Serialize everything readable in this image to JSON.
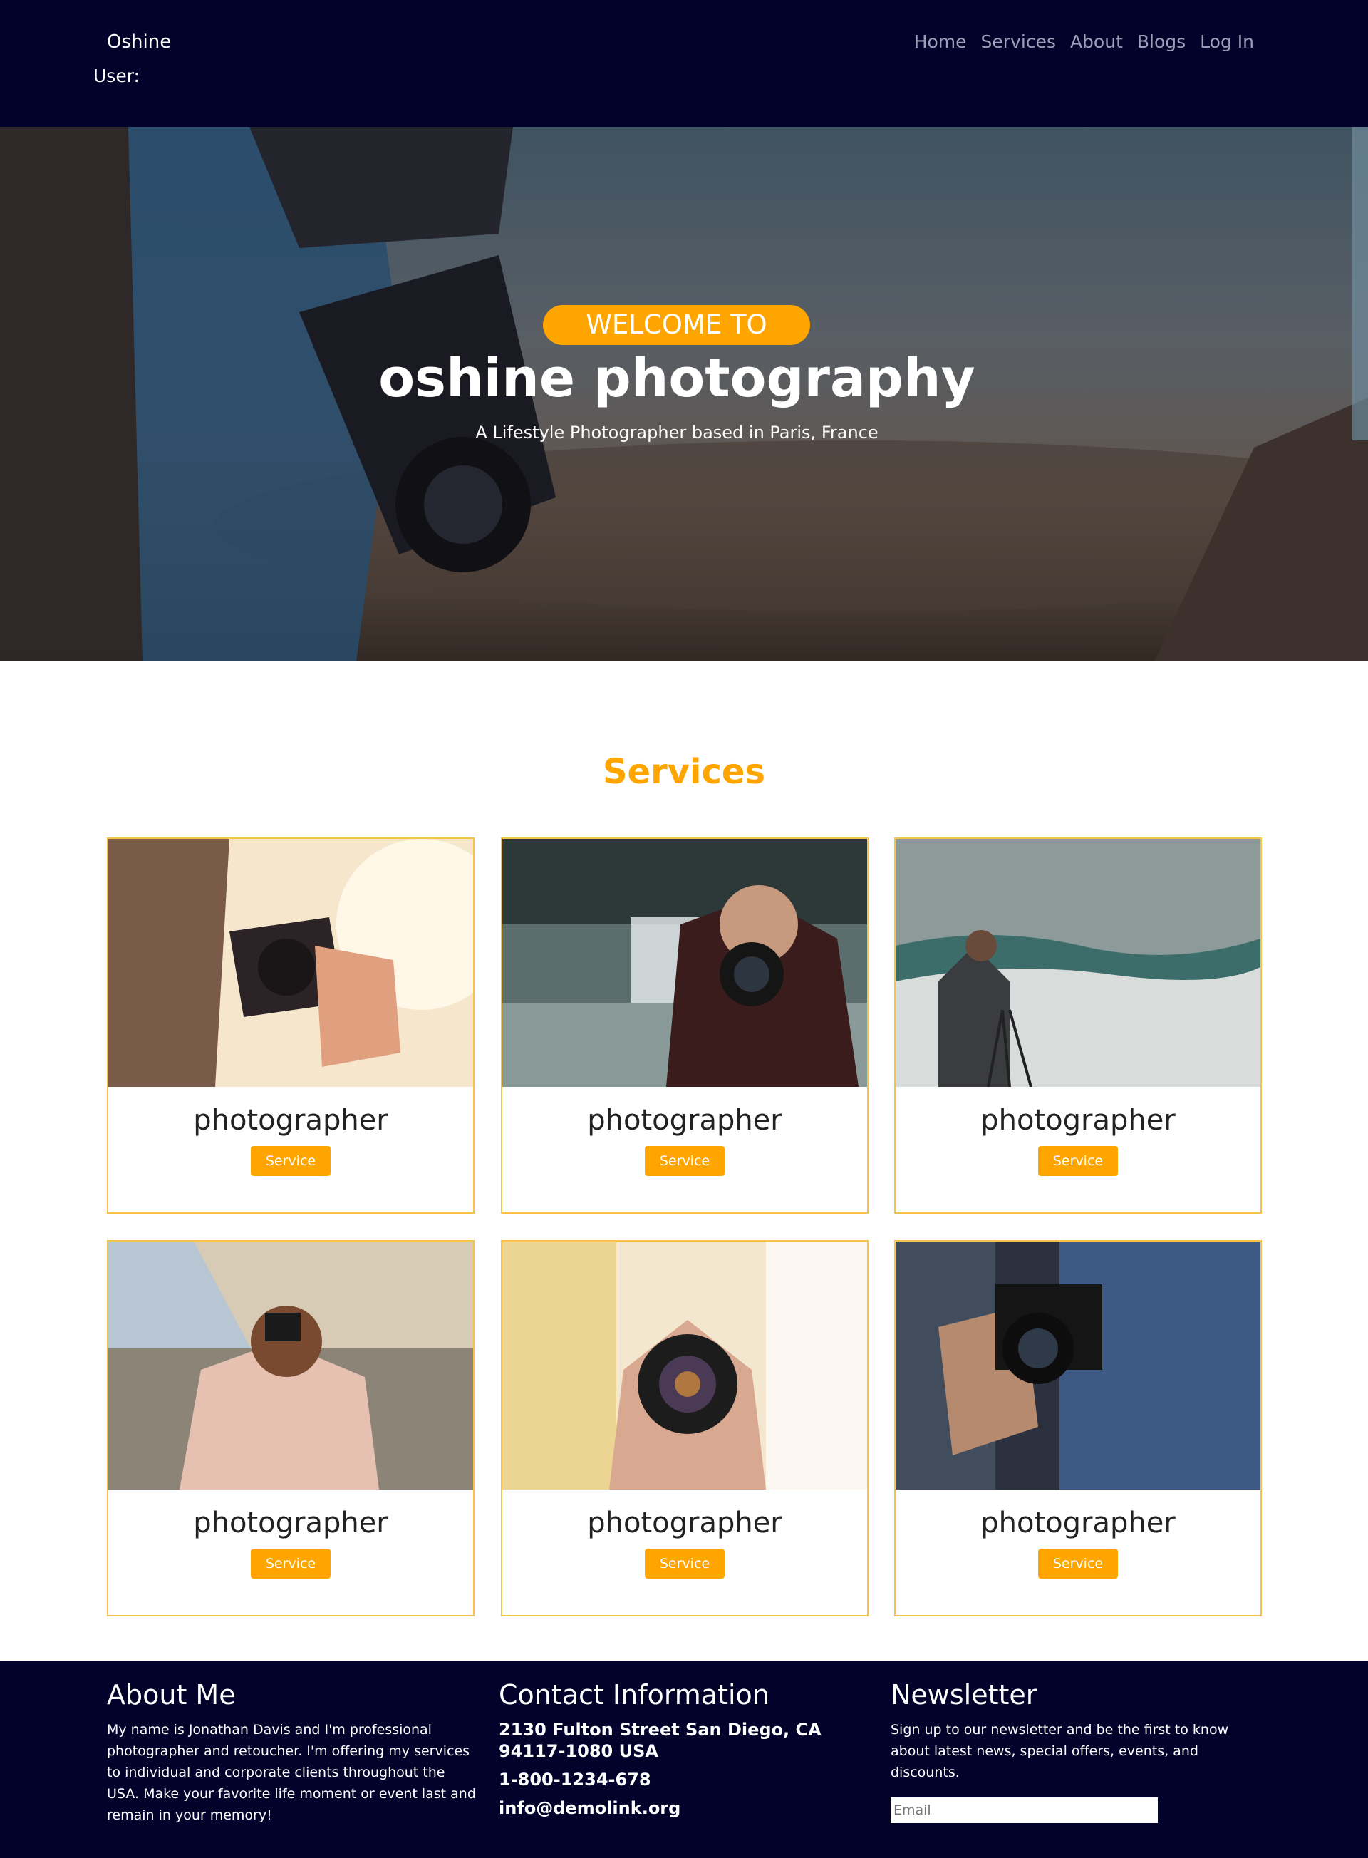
{
  "header": {
    "brand": "Oshine",
    "user_label": "User:",
    "nav": [
      "Home",
      "Services",
      "About",
      "Blogs",
      "Log In"
    ]
  },
  "hero": {
    "welcome": "WELCOME TO",
    "title": "oshine photography",
    "subtitle": "A Lifestyle Photographer based in Paris, France"
  },
  "services": {
    "title": "Services",
    "cards": [
      {
        "title": "photographer",
        "button": "Service"
      },
      {
        "title": "photographer",
        "button": "Service"
      },
      {
        "title": "photographer",
        "button": "Service"
      },
      {
        "title": "photographer",
        "button": "Service"
      },
      {
        "title": "photographer",
        "button": "Service"
      },
      {
        "title": "photographer",
        "button": "Service"
      }
    ]
  },
  "footer": {
    "about": {
      "title": "About Me",
      "text": "My name is Jonathan Davis and I'm professional photographer and retoucher. I'm offering my services to individual and corporate clients throughout the USA. Make your favorite life moment or event last and remain in your memory!"
    },
    "contact": {
      "title": "Contact Information",
      "address": "2130 Fulton Street San Diego, CA 94117-1080 USA",
      "phone": "1-800-1234-678",
      "email": "info@demolink.org"
    },
    "newsletter": {
      "title": "Newsletter",
      "text": "Sign up to our newsletter and be the first to know about latest news, special offers, events, and discounts.",
      "placeholder": "Email"
    }
  },
  "colors": {
    "accent": "#ffa500",
    "navy": "#03022b"
  }
}
